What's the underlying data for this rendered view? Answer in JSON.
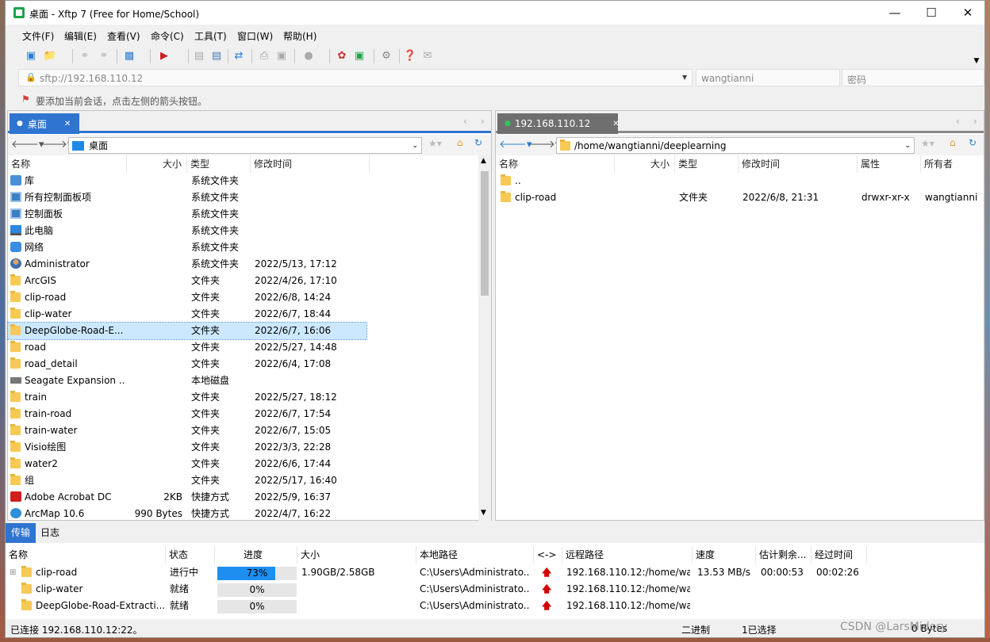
{
  "window": {
    "title": "桌面 - Xftp 7 (Free for Home/School)"
  },
  "menu": [
    "文件(F)",
    "编辑(E)",
    "查看(V)",
    "命令(C)",
    "工具(T)",
    "窗口(W)",
    "帮助(H)"
  ],
  "address": {
    "value": "sftp://192.168.110.12",
    "user": "wangtianni",
    "password_placeholder": "密码"
  },
  "hint": "要添加当前会话，点击左侧的箭头按钮。",
  "left": {
    "tab": "桌面",
    "path": "桌面",
    "columns": [
      "名称",
      "大小",
      "类型",
      "修改时间"
    ],
    "rows": [
      {
        "name": "库",
        "size": "",
        "type": "系统文件夹",
        "date": "",
        "icon": "library-icon"
      },
      {
        "name": "所有控制面板项",
        "size": "",
        "type": "系统文件夹",
        "date": "",
        "icon": "control-panel-icon"
      },
      {
        "name": "控制面板",
        "size": "",
        "type": "系统文件夹",
        "date": "",
        "icon": "control-panel-icon"
      },
      {
        "name": "此电脑",
        "size": "",
        "type": "系统文件夹",
        "date": "",
        "icon": "computer-icon"
      },
      {
        "name": "网络",
        "size": "",
        "type": "系统文件夹",
        "date": "",
        "icon": "network-icon"
      },
      {
        "name": "Administrator",
        "size": "",
        "type": "系统文件夹",
        "date": "2022/5/13, 17:12",
        "icon": "user-icon"
      },
      {
        "name": "ArcGIS",
        "size": "",
        "type": "文件夹",
        "date": "2022/4/26, 17:10",
        "icon": "folder-icon"
      },
      {
        "name": "clip-road",
        "size": "",
        "type": "文件夹",
        "date": "2022/6/8, 14:24",
        "icon": "folder-icon"
      },
      {
        "name": "clip-water",
        "size": "",
        "type": "文件夹",
        "date": "2022/6/7, 18:44",
        "icon": "folder-icon"
      },
      {
        "name": "DeepGlobe-Road-E...",
        "size": "",
        "type": "文件夹",
        "date": "2022/6/7, 16:06",
        "icon": "folder-icon",
        "selected": true
      },
      {
        "name": "road",
        "size": "",
        "type": "文件夹",
        "date": "2022/5/27, 14:48",
        "icon": "folder-icon"
      },
      {
        "name": "road_detail",
        "size": "",
        "type": "文件夹",
        "date": "2022/6/4, 17:08",
        "icon": "folder-icon"
      },
      {
        "name": "Seagate Expansion ...",
        "size": "",
        "type": "本地磁盘",
        "date": "",
        "icon": "drive-icon"
      },
      {
        "name": "train",
        "size": "",
        "type": "文件夹",
        "date": "2022/5/27, 18:12",
        "icon": "folder-icon"
      },
      {
        "name": "train-road",
        "size": "",
        "type": "文件夹",
        "date": "2022/6/7, 17:54",
        "icon": "folder-icon"
      },
      {
        "name": "train-water",
        "size": "",
        "type": "文件夹",
        "date": "2022/6/7, 15:05",
        "icon": "folder-icon"
      },
      {
        "name": "Visio绘图",
        "size": "",
        "type": "文件夹",
        "date": "2022/3/3, 22:28",
        "icon": "folder-icon"
      },
      {
        "name": "water2",
        "size": "",
        "type": "文件夹",
        "date": "2022/6/6, 17:44",
        "icon": "folder-icon"
      },
      {
        "name": "组",
        "size": "",
        "type": "文件夹",
        "date": "2022/5/17, 16:40",
        "icon": "folder-icon"
      },
      {
        "name": "Adobe Acrobat DC",
        "size": "2KB",
        "type": "快捷方式",
        "date": "2022/5/9, 16:37",
        "icon": "acrobat-icon"
      },
      {
        "name": "ArcMap 10.6",
        "size": "990 Bytes",
        "type": "快捷方式",
        "date": "2022/4/7, 16:22",
        "icon": "arcmap-icon"
      }
    ]
  },
  "right": {
    "tab": "192.168.110.12",
    "path": "/home/wangtianni/deeplearning",
    "columns": [
      "名称",
      "大小",
      "类型",
      "修改时间",
      "属性",
      "所有者"
    ],
    "rows": [
      {
        "name": "..",
        "size": "",
        "type": "",
        "date": "",
        "attr": "",
        "owner": ""
      },
      {
        "name": "clip-road",
        "size": "",
        "type": "文件夹",
        "date": "2022/6/8, 21:31",
        "attr": "drwxr-xr-x",
        "owner": "wangtianni"
      }
    ]
  },
  "transfer": {
    "tabs": [
      "传输",
      "日志"
    ],
    "columns": [
      "名称",
      "状态",
      "进度",
      "大小",
      "本地路径",
      "<->",
      "远程路径",
      "速度",
      "估计剩余...",
      "经过时间"
    ],
    "rows": [
      {
        "name": "clip-road",
        "status": "进行中",
        "progress": 0.73,
        "progress_label": "73%",
        "size": "1.90GB/2.58GB",
        "local": "C:\\Users\\Administrato...",
        "remote": "192.168.110.12:/home/wa...",
        "speed": "13.53 MB/s",
        "remaining": "00:00:53",
        "elapsed": "00:02:26"
      },
      {
        "name": "clip-water",
        "status": "就绪",
        "progress": 0,
        "progress_label": "0%",
        "size": "",
        "local": "C:\\Users\\Administrato...",
        "remote": "192.168.110.12:/home/wa...",
        "speed": "",
        "remaining": "",
        "elapsed": ""
      },
      {
        "name": "DeepGlobe-Road-Extracti...",
        "status": "就绪",
        "progress": 0,
        "progress_label": "0%",
        "size": "",
        "local": "C:\\Users\\Administrato...",
        "remote": "192.168.110.12:/home/wa...",
        "speed": "",
        "remaining": "",
        "elapsed": ""
      }
    ]
  },
  "status": {
    "left": "已连接 192.168.110.12:22。",
    "mode": "二进制",
    "selection": "1已选择",
    "bytes": "0 Bytes",
    "watermark": "CSDN @LarsMidory"
  },
  "colors": {
    "accent": "#2f74d0",
    "progress": "#1e8ff0",
    "selected_row": "#cce8ff"
  }
}
